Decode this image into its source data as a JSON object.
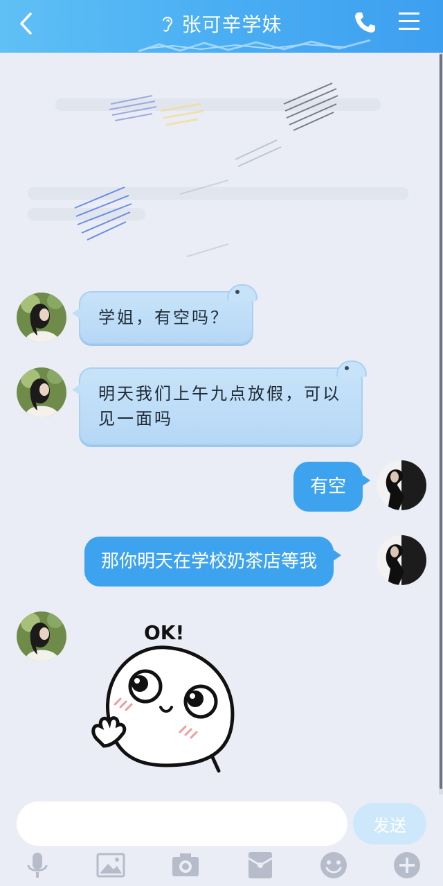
{
  "header": {
    "title": "张可辛学妹",
    "icons": [
      "back-icon",
      "ear-icon",
      "phone-icon",
      "menu-icon"
    ],
    "color": "#4aaef3"
  },
  "messages": [
    {
      "side": "in",
      "avatar": "avatar-girl",
      "text": "学姐，有空吗？"
    },
    {
      "side": "in",
      "avatar": "avatar-girl",
      "text": "明天我们上午九点放假，可以见一面吗"
    },
    {
      "side": "out",
      "avatar": "avatar-me",
      "text": "有空"
    },
    {
      "side": "out",
      "avatar": "avatar-me",
      "text": "那你明天在学校奶茶店等我"
    },
    {
      "side": "in",
      "avatar": "avatar-girl",
      "sticker": "ok-sticker",
      "sticker_text": "OK!"
    }
  ],
  "composer": {
    "placeholder": "",
    "send_label": "发送"
  },
  "toolbar": {
    "items": [
      "microphone-icon",
      "image-icon",
      "camera-icon",
      "red-packet-icon",
      "emoji-icon",
      "plus-icon"
    ]
  },
  "colors": {
    "background": "#eaedf5",
    "sent_bubble": "#3ea3ef",
    "received_bubble": "#c7e3f9",
    "send_button": "#cde8fb"
  }
}
